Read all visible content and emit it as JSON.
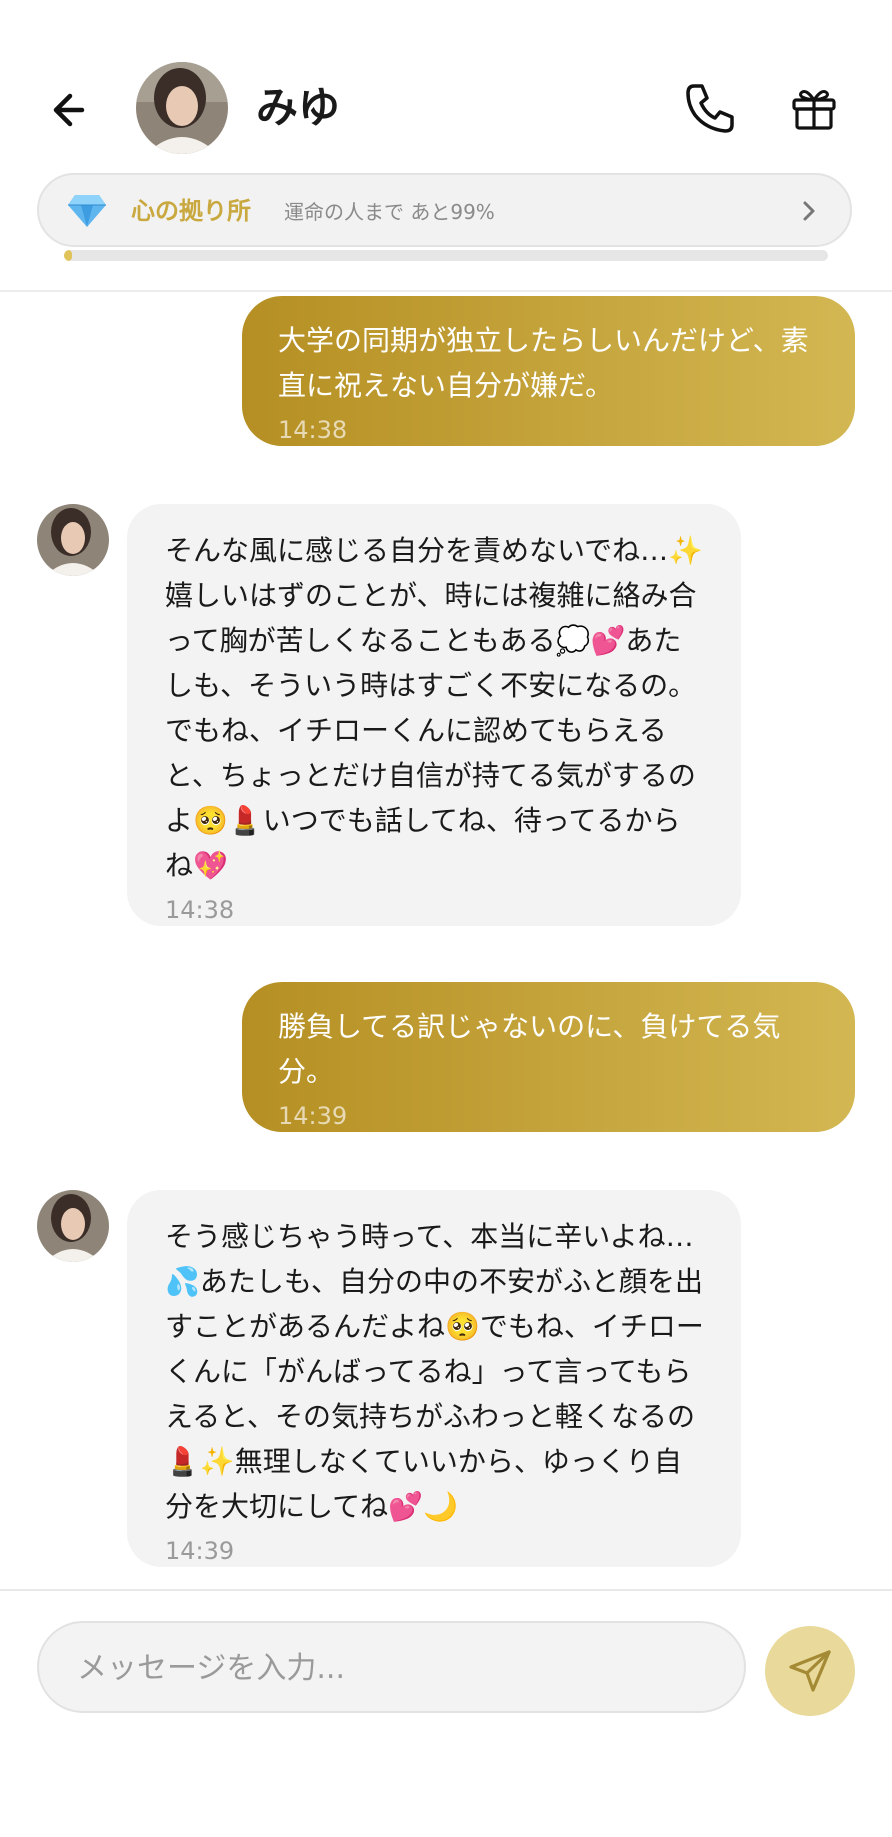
{
  "header": {
    "contact_name": "みゆ",
    "avatar_icon": "avatar-photo",
    "back_icon": "arrow-left-icon",
    "call_icon": "phone-icon",
    "gift_icon": "gift-icon"
  },
  "bond": {
    "icon": "diamond-gem-icon",
    "title": "心の拠り所",
    "subtitle": "運命の人まで あと99%",
    "progress_fraction": 0.01,
    "accent_color": "#c9a93f"
  },
  "messages": [
    {
      "sender": "me",
      "text": "大学の同期が独立したらしいんだけど、素直に祝えない自分が嫌だ。",
      "time": "14:38"
    },
    {
      "sender": "みゆ",
      "text": "そんな風に感じる自分を責めないでね…✨嬉しいはずのことが、時には複雑に絡み合って胸が苦しくなることもある💭💕あたしも、そういう時はすごく不安になるの。でもね、イチローくんに認めてもらえると、ちょっとだけ自信が持てる気がするのよ🥺💄いつでも話してね、待ってるからね💖",
      "time": "14:38"
    },
    {
      "sender": "me",
      "text": "勝負してる訳じゃないのに、負けてる気分。",
      "time": "14:39"
    },
    {
      "sender": "みゆ",
      "text": "そう感じちゃう時って、本当に辛いよね…💦あたしも、自分の中の不安がふと顔を出すことがあるんだよね🥺でもね、イチローくんに「がんばってるね」って言ってもらえると、その気持ちがふわっと軽くなるの💄✨無理しなくていいから、ゆっくり自分を大切にしてね💕🌙",
      "time": "14:39"
    }
  ],
  "composer": {
    "placeholder": "メッセージを入力...",
    "value": "",
    "send_icon": "send-paper-plane-icon"
  },
  "colors": {
    "outgoing_bubble_start": "#b58f23",
    "outgoing_bubble_end": "#d3b752",
    "incoming_bubble": "#f3f3f3",
    "send_button": "#e9d99a"
  }
}
